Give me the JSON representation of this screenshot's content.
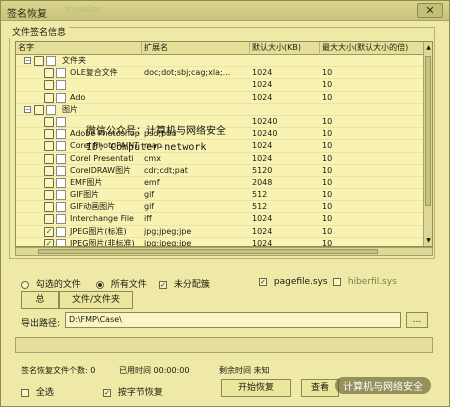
{
  "window": {
    "title": "签名恢复",
    "ghost_title": "ViewBar",
    "close_label": "✕"
  },
  "panel": {
    "group_label": "文件签名信息",
    "columns": [
      "名字",
      "扩展名",
      "默认大小(KB)",
      "最大大小(默认大小的倍)"
    ],
    "rows": [
      {
        "name": "文件夹",
        "ext": "",
        "default": "",
        "max": "",
        "checked": false,
        "tree": true
      },
      {
        "name": "OLE复合文件",
        "ext": "doc;dot;sbj;cag;xla;...",
        "default": "1024",
        "max": "10",
        "checked": false
      },
      {
        "name": "",
        "ext": "",
        "default": "1024",
        "max": "10",
        "checked": false
      },
      {
        "name": "Ado",
        "ext": "",
        "default": "1024",
        "max": "10",
        "checked": false
      },
      {
        "name": "图片",
        "ext": "",
        "default": "",
        "max": "",
        "checked": false,
        "tree": true
      },
      {
        "name": "",
        "ext": "",
        "default": "10240",
        "max": "10",
        "checked": false
      },
      {
        "name": "Adobe Photoshop",
        "ext": "psd;pdd",
        "default": "10240",
        "max": "10",
        "checked": false
      },
      {
        "name": "Corel PhotoPAINT",
        "ext": "map",
        "default": "1024",
        "max": "10",
        "checked": false
      },
      {
        "name": "Corel Presentati",
        "ext": "cmx",
        "default": "1024",
        "max": "10",
        "checked": false
      },
      {
        "name": "CorelDRAW图片",
        "ext": "cdr;cdt;pat",
        "default": "5120",
        "max": "10",
        "checked": false
      },
      {
        "name": "EMF图片",
        "ext": "emf",
        "default": "2048",
        "max": "10",
        "checked": false
      },
      {
        "name": "GIF图片",
        "ext": "gif",
        "default": "512",
        "max": "10",
        "checked": false
      },
      {
        "name": "GIF动画图片",
        "ext": "gif",
        "default": "512",
        "max": "10",
        "checked": false
      },
      {
        "name": "Interchange File",
        "ext": "iff",
        "default": "1024",
        "max": "10",
        "checked": false
      },
      {
        "name": "JPEG图片(标准)",
        "ext": "jpg;jpeg;jpe",
        "default": "1024",
        "max": "10",
        "checked": true
      },
      {
        "name": "JPEG图片(非标准)",
        "ext": "jpg;jpeg;jpe",
        "default": "1024",
        "max": "10",
        "checked": true
      },
      {
        "name": "JPEG图片(非标准)",
        "ext": "jpg;jpeg;jpe",
        "default": "1024",
        "max": "10",
        "checked": true
      }
    ],
    "watermark_line1": "微信公众号：计算机与网络安全",
    "watermark_line2": "ID: Computer-network"
  },
  "options": {
    "checked_files": "勾选的文件",
    "all_files": "所有文件",
    "unallocated": "未分配簇",
    "pagefile": "pagefile.sys",
    "hiberfil": "hiberfil.sys",
    "total_button": "总",
    "file_size_button": "文件/文件夹"
  },
  "export": {
    "label": "导出路径:",
    "path": "D:\\FMP\\Case\\",
    "browse": "..."
  },
  "status": {
    "count_label": "签名恢复文件个数: 0",
    "elapsed": "已用时间 00:00:00",
    "remaining": "剩余时间 未知"
  },
  "footer": {
    "select_all": "全选",
    "by_byte": "按字节恢复",
    "start": "开始恢复",
    "view": "查看",
    "watermark": "计算机与网络安全"
  }
}
